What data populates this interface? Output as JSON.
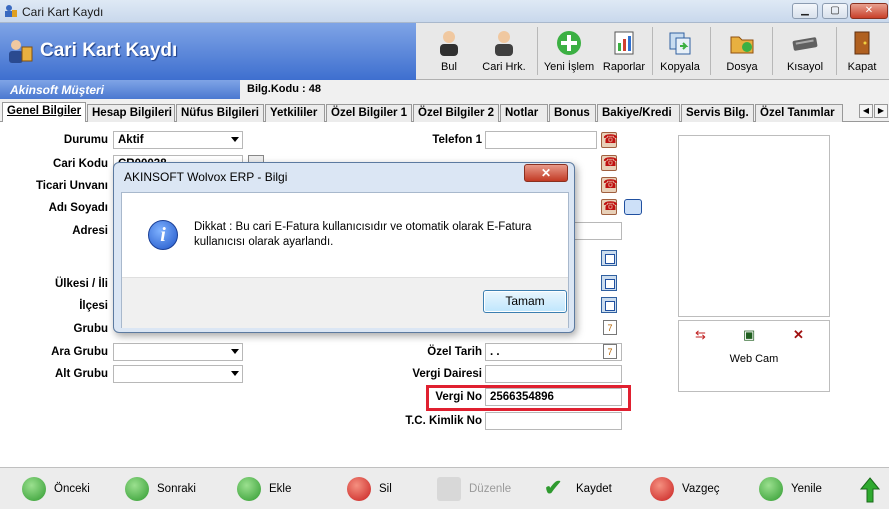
{
  "window": {
    "title": "Cari Kart Kaydı"
  },
  "banner": {
    "title": "Cari Kart Kaydı"
  },
  "toolbar": {
    "bul": "Bul",
    "cari_hrk": "Cari Hrk.",
    "yeni_islem": "Yeni İşlem",
    "raporlar": "Raporlar",
    "kopyala": "Kopyala",
    "dosya": "Dosya",
    "kisayol": "Kısayol",
    "kapat": "Kapat"
  },
  "subheader": {
    "customer": "Akinsoft Müşteri",
    "bilg_kodu": "Bilg.Kodu : 48"
  },
  "tabs": [
    "Genel Bilgiler",
    "Hesap Bilgileri",
    "Nüfus Bilgileri",
    "Yetkililer",
    "Özel Bilgiler 1",
    "Özel Bilgiler 2",
    "Notlar",
    "Bonus",
    "Bakiye/Kredi",
    "Servis Bilg.",
    "Özel Tanımlar"
  ],
  "form": {
    "durumu_label": "Durumu",
    "durumu_value": "Aktif",
    "cari_kodu_label": "Cari Kodu",
    "cari_kodu_value": "CR00038",
    "ticari_unvan_label": "Ticari Unvanı",
    "adi_soyadi_label": "Adı Soyadı",
    "adresi_label": "Adresi",
    "ulkesi_label": "Ülkesi / İli",
    "ilcesi_label": "İlçesi",
    "grubu_label": "Grubu",
    "ara_grubu_label": "Ara Grubu",
    "alt_grubu_label": "Alt Grubu",
    "telefon1_label": "Telefon 1",
    "ozel_tarih_label": "Özel Tarih",
    "ozel_tarih_value": ". .",
    "vergi_dairesi_label": "Vergi Dairesi",
    "vergi_no_label": "Vergi No",
    "vergi_no_value": "2566354896",
    "tc_kimlik_label": "T.C. Kimlik No"
  },
  "webcam": {
    "label": "Web Cam"
  },
  "footer": {
    "onceki": "Önceki",
    "sonraki": "Sonraki",
    "ekle": "Ekle",
    "sil": "Sil",
    "duzenle": "Düzenle",
    "kaydet": "Kaydet",
    "vazgec": "Vazgeç",
    "yenile": "Yenile"
  },
  "dialog": {
    "title": "AKINSOFT Wolvox ERP - Bilgi",
    "message": "Dikkat : Bu cari E-Fatura kullanıcısıdır ve otomatik olarak E-Fatura kullanıcısı olarak ayarlandı.",
    "ok": "Tamam"
  },
  "colors": {
    "accent": "#3e6fcf",
    "highlight": "#e02030"
  }
}
